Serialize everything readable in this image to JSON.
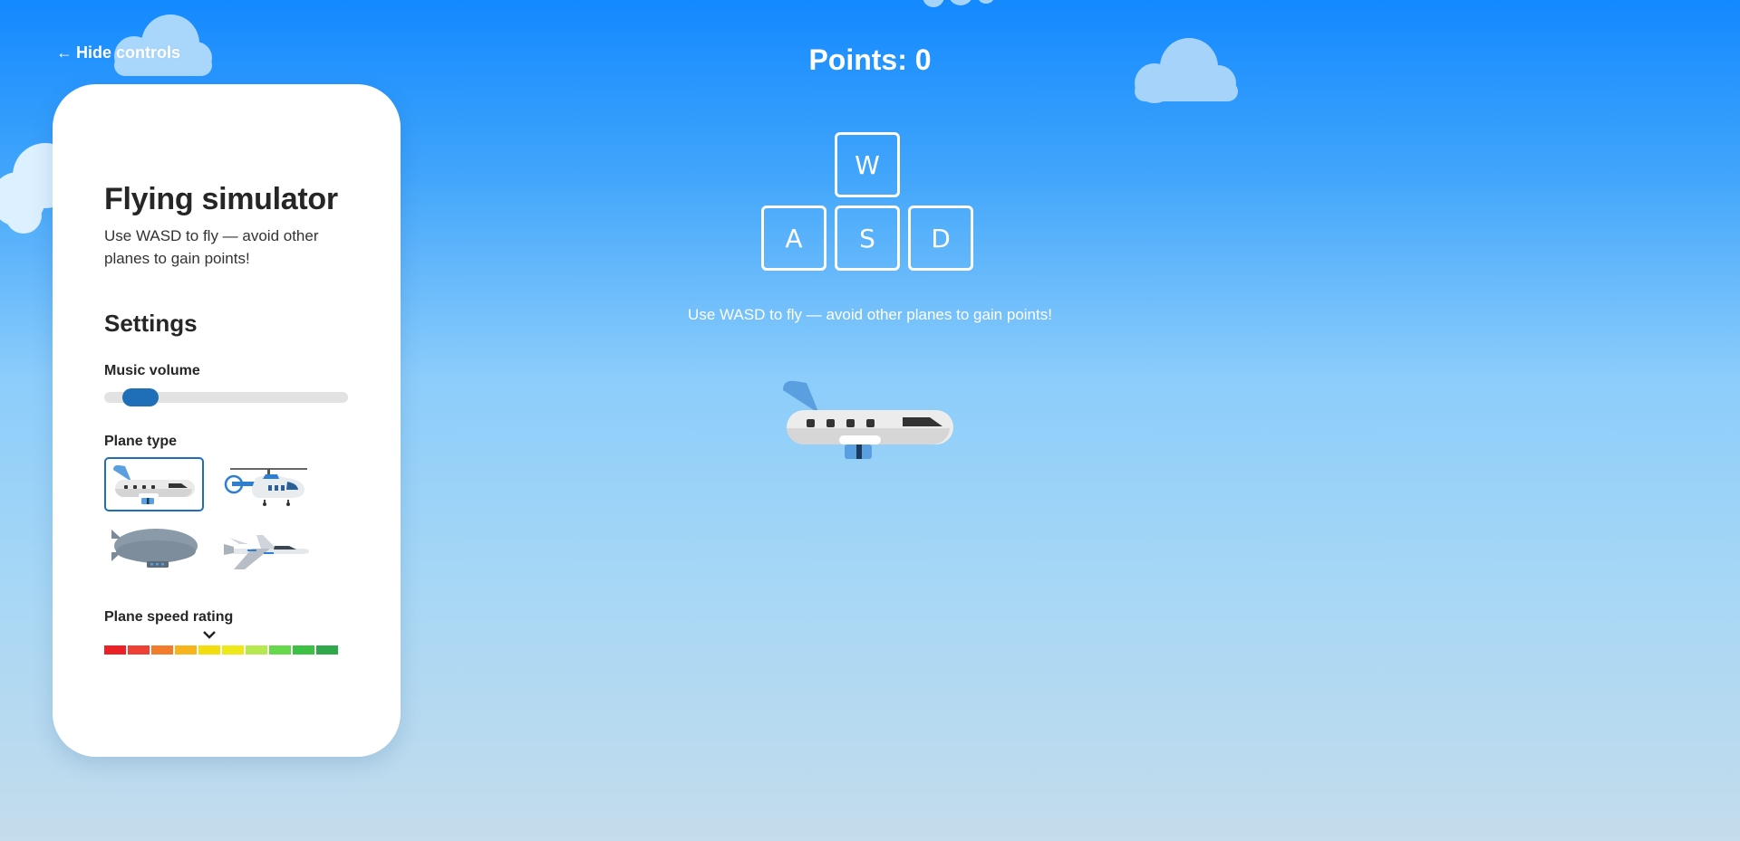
{
  "controls": {
    "hide_label": "Hide controls",
    "arrow": "←"
  },
  "panel": {
    "title": "Flying simulator",
    "subtitle": "Use WASD to fly — avoid other planes to gain points!",
    "settings_heading": "Settings",
    "music_volume_label": "Music volume",
    "music_volume_value": 0.15,
    "plane_type_label": "Plane type",
    "plane_types": [
      {
        "name": "airplane",
        "selected": true
      },
      {
        "name": "helicopter",
        "selected": false
      },
      {
        "name": "blimp",
        "selected": false
      },
      {
        "name": "fighter-jet",
        "selected": false
      }
    ],
    "speed_label": "Plane speed rating",
    "speed_rating": 5,
    "speed_segments": [
      "#ec2027",
      "#ef4035",
      "#f37b2c",
      "#f8b41d",
      "#f4dd0e",
      "#eee81a",
      "#b6e94d",
      "#66d84b",
      "#3cc144",
      "#2ea84a"
    ]
  },
  "game": {
    "points_text": "Points: 0",
    "keys": {
      "w": "W",
      "a": "A",
      "s": "S",
      "d": "D"
    },
    "hint": "Use WASD to fly — avoid other planes to gain points!"
  },
  "colors": {
    "accent": "#1f6fb8",
    "sky_top": "#1389ff",
    "sky_bottom": "#c4dcec"
  }
}
